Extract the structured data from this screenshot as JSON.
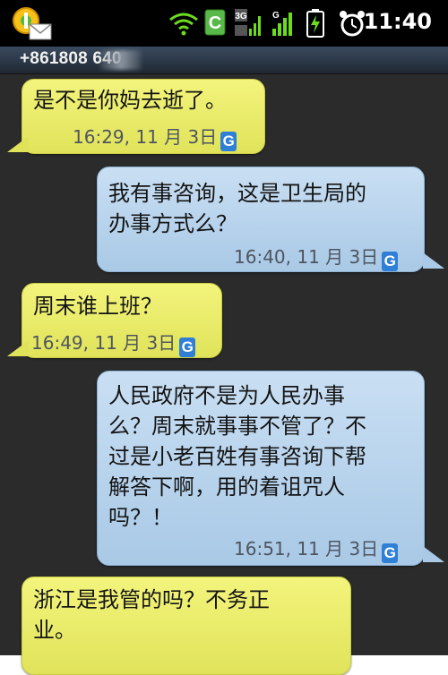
{
  "status_bar": {
    "time": "11:40",
    "icons": [
      "app-badge-icon",
      "sms-envelope-icon",
      "wifi-icon",
      "c-app-icon",
      "3g-signal-icon",
      "g-signal-icon",
      "battery-charging-icon",
      "alarm-icon"
    ],
    "signal_labels": {
      "three_g": "3G",
      "g": "G"
    }
  },
  "conversation": {
    "contact_number": "+861808   640"
  },
  "messages": [
    {
      "direction": "incoming",
      "text": "是不是你妈去逝了。",
      "time": "16:29, 11 月 3日",
      "badge": "G"
    },
    {
      "direction": "outgoing",
      "text": "我有事咨询，这是卫生局的\n办事方式么？",
      "time": "16:40, 11 月 3日",
      "badge": "G"
    },
    {
      "direction": "incoming",
      "text": "周末谁上班？",
      "time": "16:49, 11 月 3日",
      "badge": "G"
    },
    {
      "direction": "outgoing",
      "text": "人民政府不是为人民办事\n么？周末就事事不管了？不\n过是小老百姓有事咨询下帮\n解答下啊，用的着诅咒人\n吗？！",
      "time": "16:51, 11 月 3日",
      "badge": "G"
    },
    {
      "direction": "incoming",
      "text": "浙江是我管的吗？不务正\n业。",
      "time": "",
      "badge": ""
    }
  ],
  "colors": {
    "incoming_bubble": "#e9eb6a",
    "outgoing_bubble": "#b9d4ec",
    "thread_background": "#2b2b2b",
    "badge_blue": "#2f7fd6"
  }
}
